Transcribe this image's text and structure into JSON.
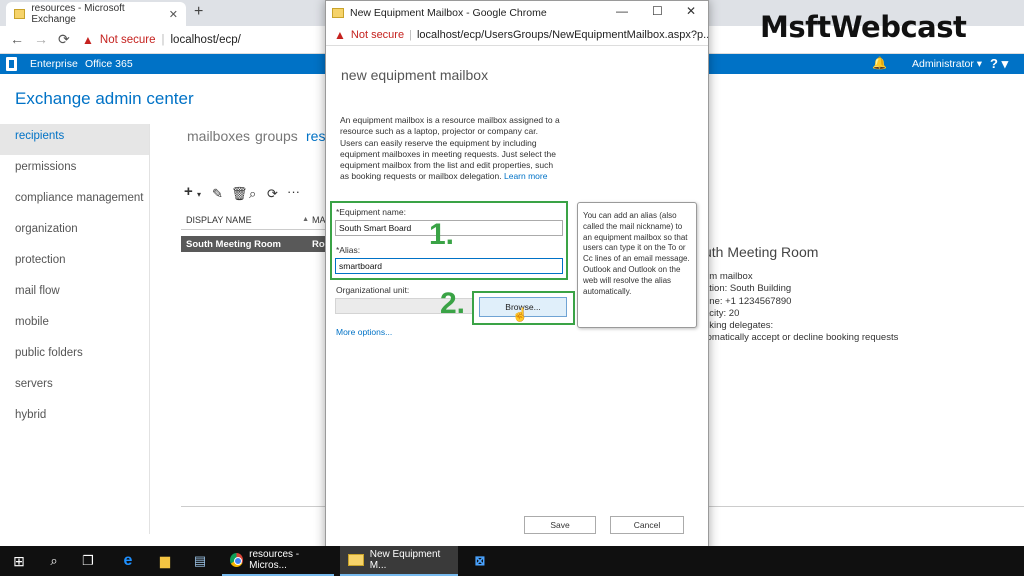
{
  "browser": {
    "tab_title": "resources - Microsoft Exchange",
    "not_secure": "Not secure",
    "url": "localhost/ecp/"
  },
  "suitebar": {
    "enterprise": "Enterprise",
    "office365": "Office 365",
    "user": "Administrator",
    "help": "?"
  },
  "eac": {
    "title": "Exchange admin center",
    "nav": [
      "recipients",
      "permissions",
      "compliance management",
      "organization",
      "protection",
      "mail flow",
      "mobile",
      "public folders",
      "servers",
      "hybrid"
    ],
    "subtabs": [
      "mailboxes",
      "groups",
      "resc"
    ],
    "grid": {
      "col_display_name": "DISPLAY NAME",
      "col_mailbox": "MA",
      "row_name": "South Meeting Room",
      "row_type": "Roo"
    },
    "detail": {
      "title": "uth Meeting Room",
      "lines": [
        "om mailbox",
        "ation: South Building",
        "one: +1 1234567890",
        "acity: 20",
        "oking delegates:",
        "tomatically accept or decline booking requests"
      ]
    }
  },
  "popup": {
    "window_title": "New Equipment Mailbox - Google Chrome",
    "not_secure": "Not secure",
    "url": "localhost/ecp/UsersGroups/NewEquipmentMailbox.aspx?p...",
    "heading": "new equipment mailbox",
    "description": "An equipment mailbox is a resource mailbox assigned to a resource such as a laptop, projector or company car. Users can easily reserve the equipment by including equipment mailboxes in meeting requests. Just select the equipment mailbox from the list and edit properties, such as booking requests or mailbox delegation.",
    "learn_more": "Learn more",
    "equipment_name_label": "*Equipment name:",
    "equipment_name_value": "South Smart Board",
    "alias_label": "*Alias:",
    "alias_value": "smartboard",
    "ou_label": "Organizational unit:",
    "browse": "Browse...",
    "more_options": "More options...",
    "save": "Save",
    "cancel": "Cancel",
    "tooltip": "You can add an alias (also called the mail nickname) to an equipment mailbox so that users can type it on the To or Cc lines of an email message. Outlook and Outlook on the web will resolve the alias automatically."
  },
  "annotations": {
    "step1": "1.",
    "step2": "2.",
    "color": "#3aa346"
  },
  "watermark": "MsftWebcast",
  "taskbar": {
    "app1": "resources - Micros...",
    "app2": "New Equipment M..."
  },
  "colors": {
    "accent": "#0072c6",
    "warning": "#c5221f",
    "taskbar": "#101010"
  }
}
